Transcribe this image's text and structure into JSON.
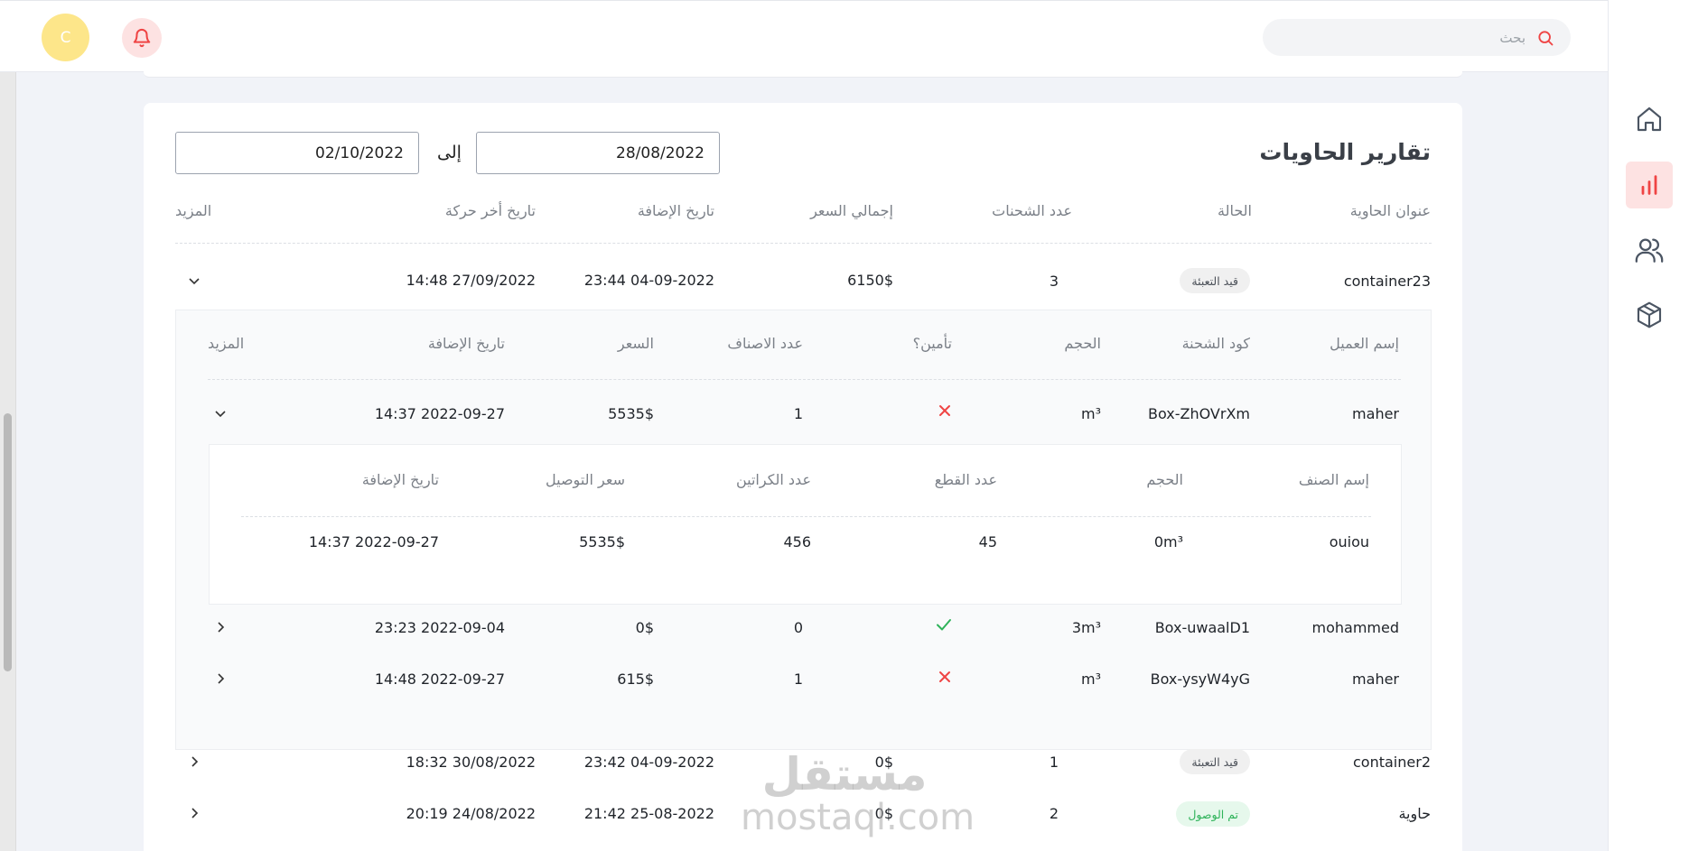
{
  "header": {
    "avatar_letter": "C",
    "search_placeholder": "بحث"
  },
  "sidebar": {
    "items": [
      {
        "icon": "home-icon",
        "active": false
      },
      {
        "icon": "bar-chart-icon",
        "active": true
      },
      {
        "icon": "users-icon",
        "active": false
      },
      {
        "icon": "box-icon",
        "active": false
      }
    ]
  },
  "report": {
    "title": "تقارير الحاويات",
    "date_from": "28/08/2022",
    "date_to_label": "إلى",
    "date_to": "02/10/2022",
    "columns": [
      "عنوان الحاوية",
      "الحالة",
      "عدد الشحنات",
      "إجمالي السعر",
      "تاريخ الإضافة",
      "تاريخ أخر حركة",
      "المزيد"
    ],
    "rows": [
      {
        "name": "container23",
        "status": "قيد التعبئة",
        "shipments": "3",
        "total": "6150$",
        "added": "23:44 04-09-2022",
        "last_move": "14:48 27/09/2022",
        "status_color": "gray"
      },
      {
        "name": "container2",
        "status": "قيد التعبئة",
        "shipments": "1",
        "total": "0$",
        "added": "23:42 04-09-2022",
        "last_move": "18:32 30/08/2022",
        "status_color": "gray"
      },
      {
        "name": "حاوية",
        "status": "تم الوصول",
        "shipments": "2",
        "total": "0$",
        "added": "21:42 25-08-2022",
        "last_move": "20:19 24/08/2022",
        "status_color": "green"
      }
    ]
  },
  "shipments": {
    "columns": [
      "إسم العميل",
      "كود الشحنة",
      "الحجم",
      "تأمين؟",
      "عدد الاصناف",
      "السعر",
      "تاريخ الإضافة",
      "المزيد"
    ],
    "rows": [
      {
        "client": "maher",
        "code": "Box-ZhOVrXm",
        "volume": "m³",
        "insured": false,
        "items": "1",
        "price": "5535$",
        "added": "14:37 2022-09-27"
      },
      {
        "client": "mohammed",
        "code": "Box-uwaalD1",
        "volume": "3m³",
        "insured": true,
        "items": "0",
        "price": "0$",
        "added": "23:23 2022-09-04"
      },
      {
        "client": "maher",
        "code": "Box-ysyW4yG",
        "volume": "m³",
        "insured": false,
        "items": "1",
        "price": "615$",
        "added": "14:48 2022-09-27"
      }
    ]
  },
  "items": {
    "columns": [
      "إسم الصنف",
      "الحجم",
      "عدد القطع",
      "عدد الكراتين",
      "سعر التوصيل",
      "تاريخ الإضافة"
    ],
    "rows": [
      {
        "name": "ouiou",
        "volume": "0m³",
        "pieces": "45",
        "cartons": "456",
        "delivery": "5535$",
        "added": "14:37 2022-09-27"
      }
    ]
  },
  "watermark": {
    "ar": "مستقل",
    "en": "mostaql.com"
  },
  "colors": {
    "accent": "#ef4444",
    "accent_bg": "#fde2e2",
    "avatar": "#fde68a",
    "green": "#2fb35a"
  }
}
